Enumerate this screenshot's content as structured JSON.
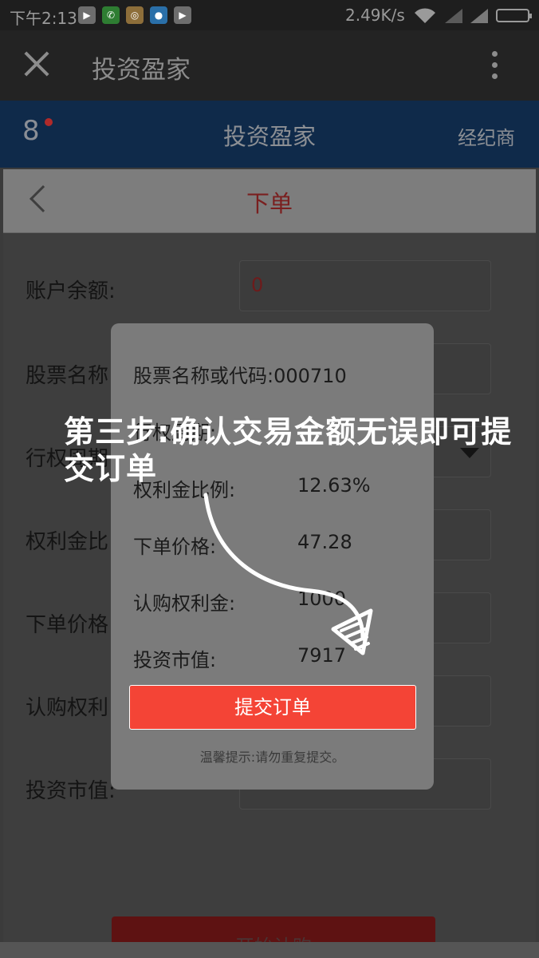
{
  "status_bar": {
    "time": "下午2:13",
    "net_speed": "2.49K/s",
    "app_icons": [
      "play-store-icon",
      "phone-icon",
      "chrome-icon",
      "browser-icon",
      "play-store-icon"
    ]
  },
  "browser": {
    "title": "投资盈家"
  },
  "app_header": {
    "title": "投资盈家",
    "broker_label": "经纪商",
    "logo_text": "8"
  },
  "page": {
    "title": "下单"
  },
  "form": {
    "rows": [
      {
        "label": "账户余额:",
        "value": "0"
      },
      {
        "label": "股票名称",
        "value": ""
      },
      {
        "label": "行权周期",
        "value": ""
      },
      {
        "label": "权利金比",
        "value": ""
      },
      {
        "label": "下单价格",
        "value": ""
      },
      {
        "label": "认购权利",
        "value": ""
      },
      {
        "label": "投资市值:",
        "value": ""
      }
    ],
    "start_button": "开始认购"
  },
  "dialog": {
    "rows": [
      {
        "label": "股票名称或代码:",
        "value": "000710"
      },
      {
        "label": "行权周期:",
        "value": ""
      },
      {
        "label": "权利金比例:",
        "value": "12.63%"
      },
      {
        "label": "下单价格:",
        "value": "47.28"
      },
      {
        "label": "认购权利金:",
        "value": "1000"
      },
      {
        "label": "投资市值:",
        "value": "7917"
      }
    ],
    "submit_label": "提交订单",
    "tip": "温馨提示:请勿重复提交。"
  },
  "tutorial_text": "第三步:确认交易金额无误即可提交订单",
  "colors": {
    "submit": "#f44436",
    "header": "#0f2a4a",
    "accent_red": "#d32f2f"
  }
}
